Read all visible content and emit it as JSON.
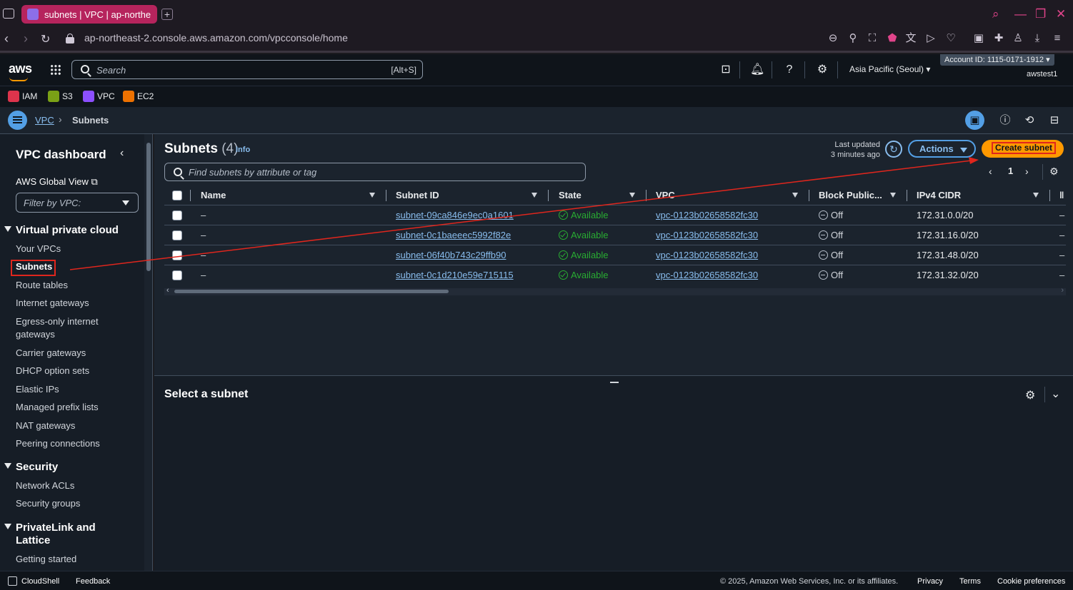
{
  "browser": {
    "tab_title": "subnets | VPC | ap-northe",
    "url": "ap-northeast-2.console.aws.amazon.com/vpcconsole/home"
  },
  "header": {
    "search_placeholder": "Search",
    "search_shortcut": "[Alt+S]",
    "region": "Asia Pacific (Seoul) ▾",
    "account_id": "Account ID: 1115-0171-1912 ▾",
    "user": "awstest1"
  },
  "favorites": [
    {
      "label": "IAM",
      "color": "#dd344c"
    },
    {
      "label": "S3",
      "color": "#7aa116"
    },
    {
      "label": "VPC",
      "color": "#8c4fff"
    },
    {
      "label": "EC2",
      "color": "#ed7100"
    }
  ],
  "breadcrumb": {
    "parent": "VPC",
    "current": "Subnets"
  },
  "sidebar": {
    "title": "VPC dashboard",
    "global_view": "AWS Global View",
    "filter_placeholder": "Filter by VPC:",
    "sections": {
      "vpc": "Virtual private cloud",
      "security": "Security",
      "privatelink_1": "PrivateLink and",
      "privatelink_2": "Lattice"
    },
    "items": {
      "your_vpcs": "Your VPCs",
      "subnets": "Subnets",
      "route_tables": "Route tables",
      "internet_gateways": "Internet gateways",
      "egress_1": "Egress-only internet",
      "egress_2": "gateways",
      "carrier_gateways": "Carrier gateways",
      "dhcp": "DHCP option sets",
      "elastic_ips": "Elastic IPs",
      "prefix_lists": "Managed prefix lists",
      "nat": "NAT gateways",
      "peering": "Peering connections",
      "network_acls": "Network ACLs",
      "security_groups": "Security groups",
      "getting_started": "Getting started"
    }
  },
  "main": {
    "title": "Subnets",
    "count": "(4)",
    "info": "Info",
    "last_updated_1": "Last updated",
    "last_updated_2": "3 minutes ago",
    "actions": "Actions",
    "create": "Create subnet",
    "find_placeholder": "Find subnets by attribute or tag",
    "page": "1",
    "columns": [
      "Name",
      "Subnet ID",
      "State",
      "VPC",
      "Block Public...",
      "IPv4 CIDR"
    ],
    "rows": [
      {
        "name": "–",
        "subnet_id": "subnet-09ca846e9ec0a1601",
        "state": "Available",
        "vpc": "vpc-0123b02658582fc30",
        "block": "Off",
        "cidr": "172.31.0.0/20",
        "more": "–"
      },
      {
        "name": "–",
        "subnet_id": "subnet-0c1baeeec5992f82e",
        "state": "Available",
        "vpc": "vpc-0123b02658582fc30",
        "block": "Off",
        "cidr": "172.31.16.0/20",
        "more": "–"
      },
      {
        "name": "–",
        "subnet_id": "subnet-06f40b743c29ffb90",
        "state": "Available",
        "vpc": "vpc-0123b02658582fc30",
        "block": "Off",
        "cidr": "172.31.48.0/20",
        "more": "–"
      },
      {
        "name": "–",
        "subnet_id": "subnet-0c1d210e59e715115",
        "state": "Available",
        "vpc": "vpc-0123b02658582fc30",
        "block": "Off",
        "cidr": "172.31.32.0/20",
        "more": "–"
      }
    ],
    "details_title": "Select a subnet"
  },
  "footer": {
    "cloudshell": "CloudShell",
    "feedback": "Feedback",
    "copyright": "© 2025, Amazon Web Services, Inc. or its affiliates.",
    "privacy": "Privacy",
    "terms": "Terms",
    "cookies": "Cookie preferences"
  },
  "colors": {
    "accent": "#539fe5",
    "create_button": "#ff9900",
    "annotation": "#e0261d",
    "available": "#29ad32"
  }
}
